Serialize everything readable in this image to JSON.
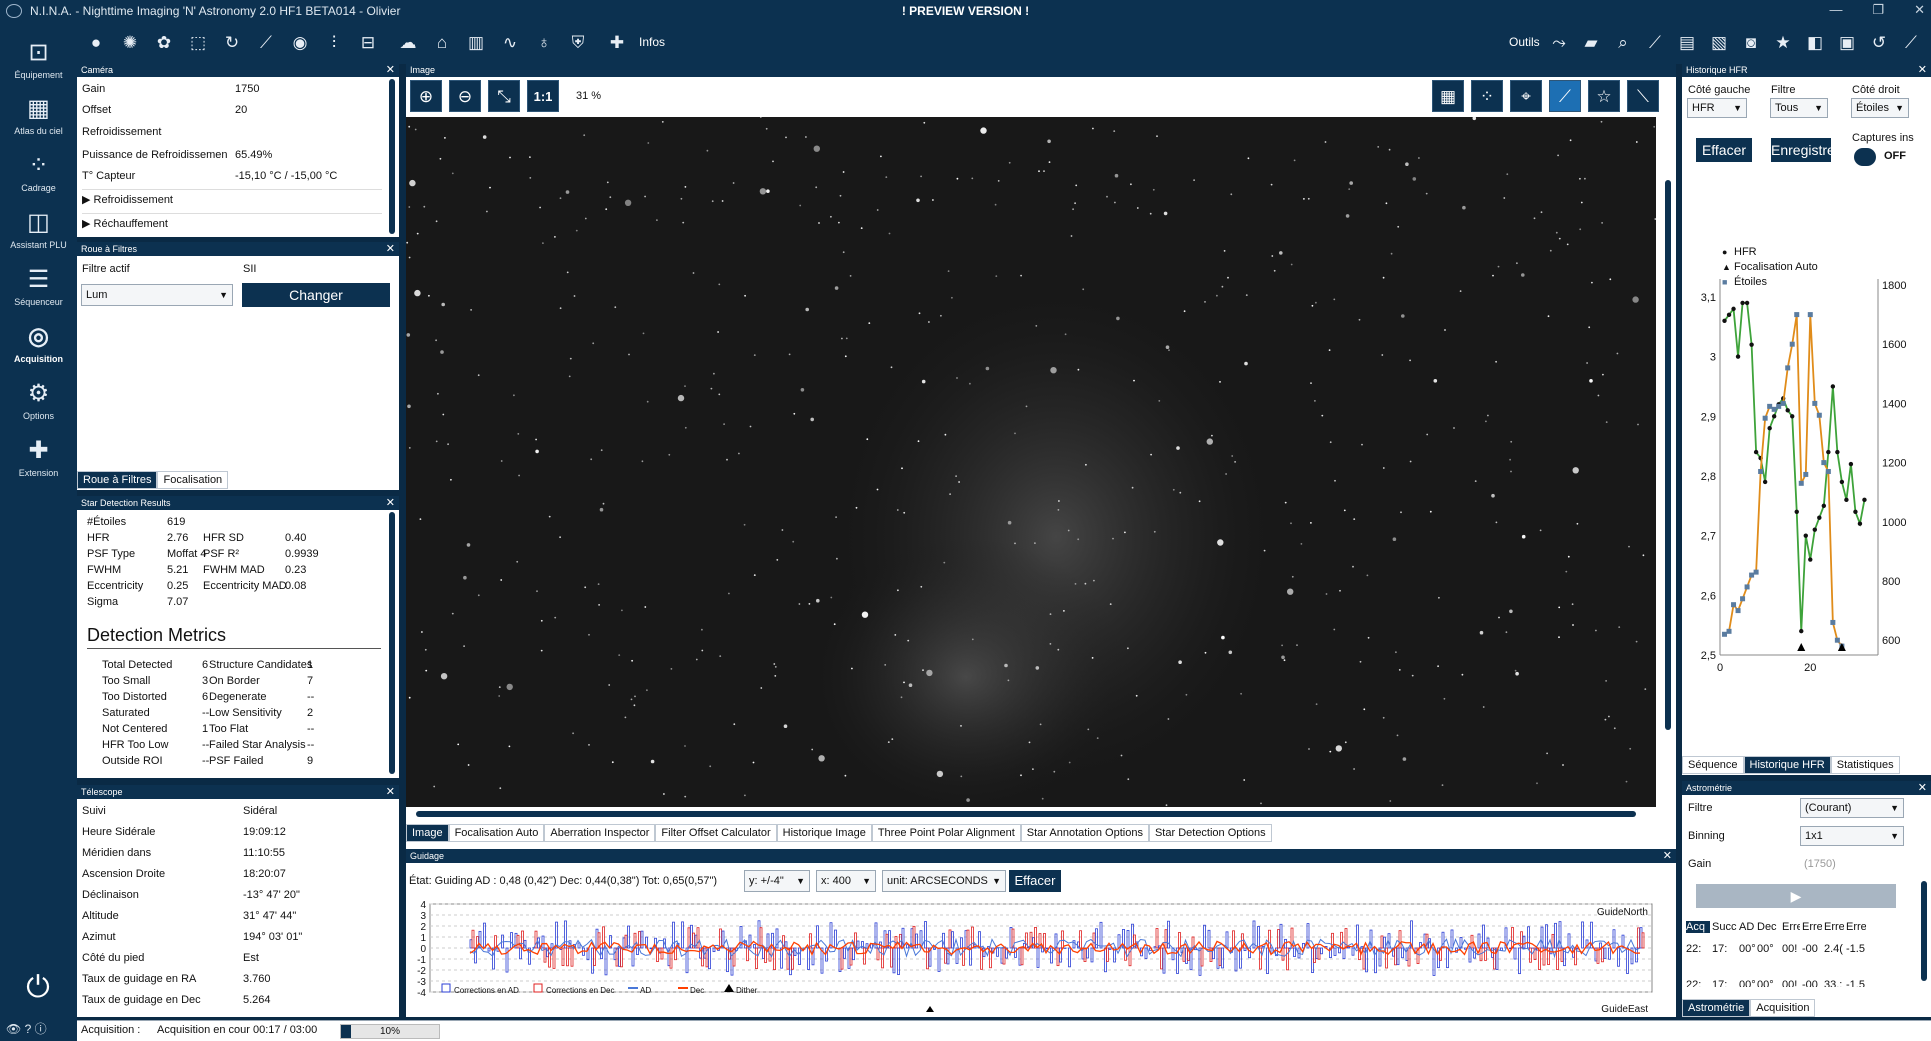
{
  "window": {
    "title": "N.I.N.A. - Nighttime Imaging 'N' Astronomy 2.0 HF1 BETA014  -  Olivier",
    "preview": "! PREVIEW VERSION !",
    "controls": [
      "—",
      "❐",
      "✕"
    ]
  },
  "toolbar": {
    "infos_label": "Infos",
    "outils_label": "Outils"
  },
  "sidebar": {
    "items": [
      {
        "label": "Équipement",
        "icon": "telescope-icon"
      },
      {
        "label": "Atlas du ciel",
        "icon": "sky-atlas-icon"
      },
      {
        "label": "Cadrage",
        "icon": "framing-icon"
      },
      {
        "label": "Assistant PLU",
        "icon": "flat-wizard-icon"
      },
      {
        "label": "Séquenceur",
        "icon": "sequencer-icon"
      },
      {
        "label": "Acquisition",
        "icon": "imaging-icon"
      },
      {
        "label": "Options",
        "icon": "gear-icon"
      },
      {
        "label": "Extension",
        "icon": "puzzle-icon"
      }
    ]
  },
  "camera": {
    "title": "Caméra",
    "rows": [
      {
        "label": "Gain",
        "value": "1750"
      },
      {
        "label": "Offset",
        "value": "20"
      },
      {
        "label": "Refroidissement",
        "value": ""
      },
      {
        "label": "Puissance de Refroidissemen",
        "value": "65.49%"
      },
      {
        "label": "T° Capteur",
        "value": "-15,10 °C / -15,00 °C"
      }
    ],
    "expanders": [
      "Refroidissement",
      "Réchauffement"
    ]
  },
  "filterwheel": {
    "title": "Roue à Filtres",
    "active_label": "Filtre actif",
    "active_value": "SII",
    "selected": "Lum",
    "change_label": "Changer",
    "tabs": [
      "Roue à Filtres",
      "Focalisation"
    ]
  },
  "stardetect": {
    "title": "Star Detection Results",
    "rows": [
      {
        "l": "#Étoiles",
        "v": "619",
        "l2": "",
        "v2": ""
      },
      {
        "l": "HFR",
        "v": "2.76",
        "l2": "HFR SD",
        "v2": "0.40"
      },
      {
        "l": "PSF Type",
        "v": "Moffat 4",
        "l2": "PSF R²",
        "v2": "0.9939"
      },
      {
        "l": "FWHM",
        "v": "5.21",
        "l2": "FWHM MAD",
        "v2": "0.23"
      },
      {
        "l": "Eccentricity",
        "v": "0.25",
        "l2": "Eccentricity MAD",
        "v2": "0.08"
      },
      {
        "l": "Sigma",
        "v": "7.07",
        "l2": "",
        "v2": ""
      }
    ],
    "metrics_title": "Detection Metrics",
    "metrics": [
      {
        "l": "Total Detected",
        "v": "6",
        "l2": "Structure Candidates",
        "v2": "1"
      },
      {
        "l": "Too Small",
        "v": "3",
        "l2": "On Border",
        "v2": "7"
      },
      {
        "l": "Too Distorted",
        "v": "6",
        "l2": "Degenerate",
        "v2": "--"
      },
      {
        "l": "Saturated",
        "v": "--",
        "l2": "Low Sensitivity",
        "v2": "2"
      },
      {
        "l": "Not Centered",
        "v": "1",
        "l2": "Too Flat",
        "v2": "--"
      },
      {
        "l": "HFR Too Low",
        "v": "--",
        "l2": "Failed Star Analysis",
        "v2": "--"
      },
      {
        "l": "Outside ROI",
        "v": "--",
        "l2": "PSF Failed",
        "v2": "9"
      }
    ]
  },
  "telescope": {
    "title": "Télescope",
    "rows": [
      {
        "label": "Suivi",
        "value": "Sidéral"
      },
      {
        "label": "Heure Sidérale",
        "value": "19:09:12"
      },
      {
        "label": "Méridien dans",
        "value": "11:10:55"
      },
      {
        "label": "Ascension Droite",
        "value": "18:20:07"
      },
      {
        "label": "Déclinaison",
        "value": "-13° 47' 20\""
      },
      {
        "label": "Altitude",
        "value": "31° 47' 44\""
      },
      {
        "label": "Azimut",
        "value": "194° 03' 01\""
      },
      {
        "label": "Côté du pied",
        "value": "Est"
      },
      {
        "label": "Taux de guidage en RA",
        "value": "3.760"
      },
      {
        "label": "Taux de guidage en Dec",
        "value": "5.264"
      }
    ]
  },
  "image": {
    "title": "Image",
    "zoom": "31 %",
    "one_to_one": "1:1",
    "tabs": [
      "Image",
      "Focalisation Auto",
      "Aberration Inspector",
      "Filter Offset Calculator",
      "Historique Image",
      "Three Point Polar Alignment",
      "Star Annotation Options",
      "Star Detection Options"
    ]
  },
  "guiding": {
    "title": "Guidage",
    "status": "État: Guiding  AD : 0,48 (0,42\")  Dec: 0,44(0,38\")  Tot: 0,65(0,57\")",
    "y_select": "y: +/-4\"",
    "x_select": "x: 400",
    "unit_select": "unit: ARCSECONDS",
    "clear": "Effacer",
    "north": "GuideNorth",
    "east": "GuideEast",
    "y_ticks": [
      "4",
      "3",
      "2",
      "1",
      "0",
      "-1",
      "-2",
      "-3",
      "-4"
    ],
    "legend": [
      "Corrections en AD",
      "Corrections en Dec",
      "AD",
      "Dec",
      "Dither"
    ],
    "colors": {
      "ra": "#2b3fd6",
      "dec": "#e02020",
      "ra_line": "#4a78d8",
      "dec_line": "#ff4000"
    }
  },
  "hfr": {
    "title": "Historique HFR",
    "left_label": "Côté gauche",
    "left_value": "HFR",
    "filter_label": "Filtre",
    "filter_value": "Tous",
    "right_label": "Côté droit",
    "right_value": "Étoiles",
    "clear": "Effacer",
    "save": "Enregistre",
    "captures_label": "Captures ins",
    "toggle": "OFF",
    "legend": [
      "HFR",
      "Focalisation Auto",
      "Étoiles"
    ],
    "tabs": [
      "Séquence",
      "Historique HFR",
      "Statistiques"
    ]
  },
  "chart_data": {
    "type": "line",
    "x": [
      0,
      1,
      2,
      3,
      4,
      5,
      6,
      7,
      8,
      9,
      10,
      11,
      12,
      13,
      14,
      15,
      16,
      17,
      18,
      19,
      20,
      21,
      22,
      23,
      24,
      25,
      26,
      27,
      28,
      29,
      30,
      31,
      32,
      33,
      34,
      35
    ],
    "ylim": [
      2.5,
      3.12
    ],
    "y2lim": [
      550,
      1800
    ],
    "yticks": [
      "3,1",
      "3",
      "2,9",
      "2,8",
      "2,7",
      "2,6",
      "2,5"
    ],
    "y2ticks": [
      "1800",
      "1600",
      "1400",
      "1200",
      "1000",
      "800",
      "600"
    ],
    "xticks": [
      "0",
      "20"
    ],
    "series": [
      {
        "name": "HFR",
        "color": "#3ea33a",
        "values": [
          3.06,
          3.07,
          3.08,
          3.0,
          3.09,
          3.09,
          3.02,
          2.84,
          2.83,
          2.79,
          2.88,
          2.9,
          2.92,
          2.93,
          2.91,
          2.9,
          2.74,
          2.54,
          2.7,
          2.66,
          2.71,
          2.73,
          2.75,
          2.84,
          2.95,
          2.84,
          2.79,
          2.76,
          2.82,
          2.74,
          2.72,
          2.76
        ]
      },
      {
        "name": "Étoiles",
        "color": "#e08c1a",
        "values": [
          620,
          630,
          720,
          700,
          740,
          780,
          820,
          830,
          1170,
          1350,
          1390,
          1380,
          1390,
          1400,
          1520,
          1600,
          1700,
          1130,
          1160,
          1700,
          1400,
          1360,
          1200,
          1170,
          660,
          600,
          580
        ]
      }
    ],
    "autofocus_x": [
      18,
      27
    ]
  },
  "astrometry": {
    "title": "Astrométrie",
    "filter_label": "Filtre",
    "filter_value": "(Courant)",
    "binning_label": "Binning",
    "binning_value": "1x1",
    "gain_label": "Gain",
    "gain_value": "(1750)",
    "headers": [
      "Acq",
      "Succ",
      "AD",
      "Dec",
      "Erre",
      "Erre",
      "Erre",
      "Erre"
    ],
    "rows": [
      [
        "22:",
        "17:",
        "00°",
        "00°",
        "00!",
        "-00",
        "2.4(",
        "-1.5"
      ],
      [
        "22:",
        "17:",
        "00°",
        "00°",
        "00!",
        "-00",
        "33.:",
        "-1.5"
      ]
    ],
    "tabs": [
      "Astrométrie",
      "Acquisition"
    ]
  },
  "statusbar": {
    "label": "Acquisition :",
    "value": "Acquisition en cour 00:17 / 03:00",
    "progress": 10,
    "progress_text": "10%"
  }
}
